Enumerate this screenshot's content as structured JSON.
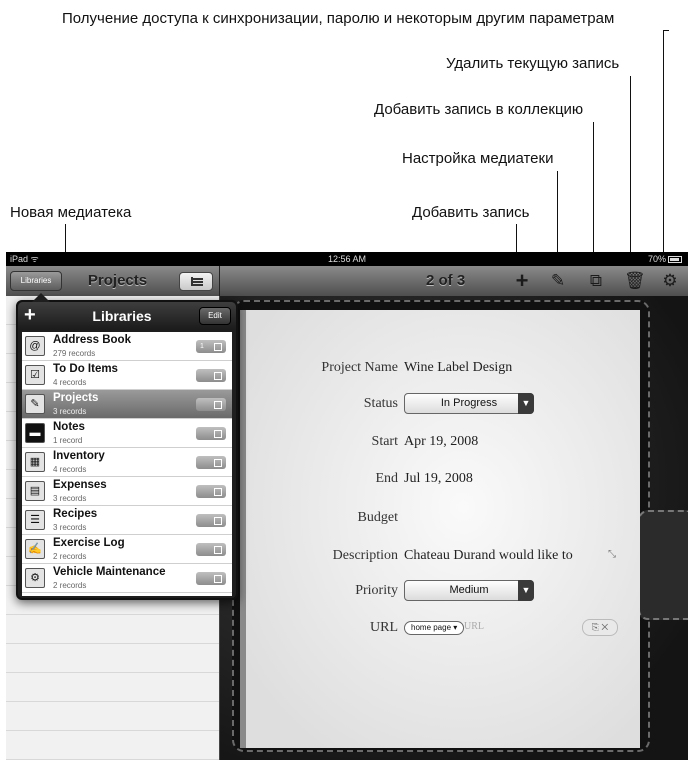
{
  "callouts": {
    "access_settings": "Получение доступа к синхронизации, паролю и некоторым другим параметрам",
    "delete_record": "Удалить текущую запись",
    "add_to_collection": "Добавить запись в коллекцию",
    "library_settings": "Настройка медиатеки",
    "add_record": "Добавить запись",
    "new_library": "Новая медиатека"
  },
  "status_bar": {
    "device": "iPad ᯤ",
    "time": "12:56 AM",
    "battery": "70%"
  },
  "left_nav": {
    "libraries_button": "Libraries",
    "title": "Projects"
  },
  "toolbar": {
    "record_position": "2 of 3",
    "icons": [
      "plus-icon",
      "pencil-icon",
      "collection-icon",
      "trash-icon",
      "gear-icon"
    ]
  },
  "popover": {
    "add_label": "+",
    "title": "Libraries",
    "edit_label": "Edit",
    "libraries": [
      {
        "name": "Address Book",
        "count": "279 records",
        "badge": "1",
        "icon": "address-book-icon"
      },
      {
        "name": "To Do Items",
        "count": "4 records",
        "badge": "",
        "icon": "todo-icon"
      },
      {
        "name": "Projects",
        "count": "3 records",
        "badge": "",
        "icon": "projects-icon",
        "selected": true
      },
      {
        "name": "Notes",
        "count": "1 record",
        "badge": "",
        "icon": "notes-icon"
      },
      {
        "name": "Inventory",
        "count": "4 records",
        "badge": "",
        "icon": "inventory-icon"
      },
      {
        "name": "Expenses",
        "count": "3 records",
        "badge": "",
        "icon": "expenses-icon"
      },
      {
        "name": "Recipes",
        "count": "3 records",
        "badge": "",
        "icon": "recipes-icon"
      },
      {
        "name": "Exercise Log",
        "count": "2 records",
        "badge": "",
        "icon": "exercise-icon"
      },
      {
        "name": "Vehicle Maintenance",
        "count": "2 records",
        "badge": "",
        "icon": "vehicle-icon"
      }
    ]
  },
  "record": {
    "project_name": {
      "label": "Project Name",
      "value": "Wine Label Design"
    },
    "status": {
      "label": "Status",
      "value": "In Progress"
    },
    "start": {
      "label": "Start",
      "value": "Apr 19, 2008"
    },
    "end": {
      "label": "End",
      "value": "Jul 19, 2008"
    },
    "budget": {
      "label": "Budget",
      "value": ""
    },
    "description": {
      "label": "Description",
      "value": "Chateau Durand would like to"
    },
    "priority": {
      "label": "Priority",
      "value": "Medium"
    },
    "url": {
      "label": "URL",
      "type_value": "home page ▾",
      "placeholder": "URL"
    }
  }
}
